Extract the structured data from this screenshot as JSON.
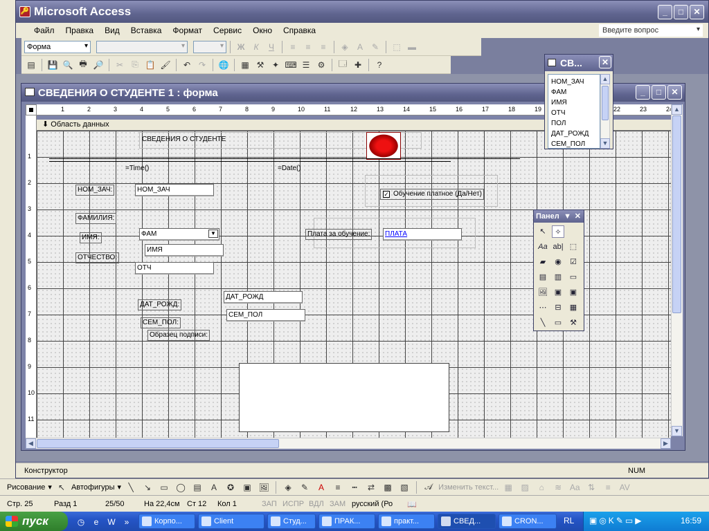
{
  "app_title": "Microsoft Access",
  "menu": [
    "Файл",
    "Правка",
    "Вид",
    "Вставка",
    "Формат",
    "Сервис",
    "Окно",
    "Справка"
  ],
  "ask_placeholder": "Введите вопрос",
  "toolbar": {
    "object_combo": "Форма"
  },
  "form_window_title": "СВЕДЕНИЯ О СТУДЕНТЕ 1 : форма",
  "section_header": "Область данных",
  "ruler_h": [
    "1",
    "2",
    "3",
    "4",
    "5",
    "6",
    "7",
    "8",
    "9",
    "10",
    "11",
    "12",
    "13",
    "14",
    "15",
    "16",
    "17",
    "18",
    "19",
    "20",
    "21",
    "22",
    "23",
    "24"
  ],
  "ruler_v": [
    "1",
    "2",
    "3",
    "4",
    "5",
    "6",
    "7",
    "8",
    "9",
    "10",
    "11"
  ],
  "form": {
    "title_label": "СВЕДЕНИЯ О СТУДЕНТЕ",
    "time_expr": "=Time()",
    "date_expr": "=Date()",
    "nom_zach_label": "НОМ_ЗАЧ:",
    "nom_zach_field": "НОМ_ЗАЧ",
    "familia_label": "ФАМИЛИЯ:",
    "fam_combo": "ФАМ",
    "imya_label": "ИМЯ:",
    "imya_field": "ИМЯ",
    "otchestvo_label": "ОТЧЕСТВО:",
    "otch_field": "ОТЧ",
    "dat_rozhd_label": "ДАТ_РОЖД:",
    "dat_rozhd_field": "ДАТ_РОЖД",
    "sem_pol_label": "СЕМ_ПОЛ:",
    "sem_pol_field": "СЕМ_ПОЛ",
    "signature_label": "Образец подписи:",
    "paid_checkbox_label": "Обучение платное (Да/Нет)",
    "payment_label": "Плата за обучение:",
    "payment_field": "ПЛАТА"
  },
  "field_list": {
    "title": "СВ...",
    "items": [
      "НОМ_ЗАЧ",
      "ФАМ",
      "ИМЯ",
      "ОТЧ",
      "ПОЛ",
      "ДАТ_РОЖД",
      "СЕМ_ПОЛ"
    ]
  },
  "toolbox_title": "Панел",
  "status": {
    "mode": "Конструктор",
    "num": "NUM"
  },
  "draw_toolbar": {
    "drawing": "Рисование",
    "autoshapes": "Автофигуры",
    "edit_text": "Изменить текст..."
  },
  "word_status": {
    "page": "Стр. 25",
    "section": "Разд 1",
    "pages": "25/50",
    "at": "На 22,4см",
    "line": "Ст 12",
    "col": "Кол 1",
    "rec": "ЗАП",
    "trk": "ИСПР",
    "ext": "ВДЛ",
    "ovr": "ЗАМ",
    "lang": "русский (Ро"
  },
  "taskbar": {
    "start": "пуск",
    "tasks": [
      "Корпо...",
      "Client",
      "Студ...",
      "ПРАК...",
      "практ...",
      "СВЕД...",
      "CRON..."
    ],
    "lang": "RL",
    "clock": "16:59"
  }
}
